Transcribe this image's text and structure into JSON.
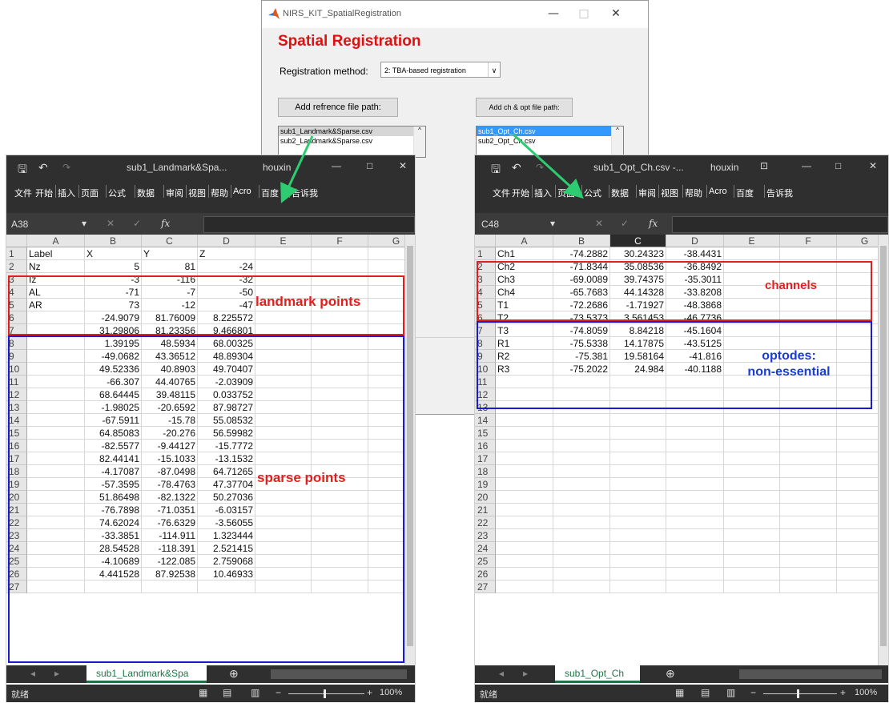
{
  "colors": {
    "accent_red": "#e02020",
    "accent_blue": "#1a3cd6",
    "excel_green": "#217346",
    "dark_ui": "#2f2f2f",
    "highlight": "#3399ff"
  },
  "matlab": {
    "window_title": "NIRS_KIT_SpatialRegistration",
    "heading": "Spatial Registration",
    "method_label": "Registration method:",
    "method_value": "2: TBA-based registration",
    "btn_ref": "Add refrence file path:",
    "btn_ch": "Add ch & opt file path:",
    "ref_files": [
      "sub1_Landmark&Sparse.csv",
      "sub2_Landmark&Sparse.csv"
    ],
    "ch_files": [
      "sub1_Opt_Ch.csv",
      "sub2_Opt_Ch.csv"
    ]
  },
  "excel_common": {
    "ribbon_tabs": [
      "文件",
      "开始",
      "插入",
      "页面",
      "公式",
      "数据",
      "审阅",
      "视图",
      "帮助",
      "Acro",
      "百度",
      "告诉我"
    ],
    "status": "就绪",
    "zoom": "100%",
    "fx": "fx"
  },
  "excel_left": {
    "title": "sub1_Landmark&Spa...",
    "user": "houxin",
    "name_box": "A38",
    "sheet_tab": "sub1_Landmark&Spa",
    "columns": [
      "A",
      "B",
      "C",
      "D",
      "E",
      "F",
      "G"
    ],
    "rows": [
      [
        "Label",
        "X",
        "Y",
        "Z"
      ],
      [
        "Nz",
        "5",
        "81",
        "-24"
      ],
      [
        "Iz",
        "-3",
        "-116",
        "-32"
      ],
      [
        "AL",
        "-71",
        "-7",
        "-50"
      ],
      [
        "AR",
        "73",
        "-12",
        "-47"
      ],
      [
        "",
        "-24.9079",
        "81.76009",
        "8.225572"
      ],
      [
        "",
        "31.29806",
        "81.23356",
        "9.466801"
      ],
      [
        "",
        "1.39195",
        "48.5934",
        "68.00325"
      ],
      [
        "",
        "-49.0682",
        "43.36512",
        "48.89304"
      ],
      [
        "",
        "49.52336",
        "40.8903",
        "49.70407"
      ],
      [
        "",
        "-66.307",
        "44.40765",
        "-2.03909"
      ],
      [
        "",
        "68.64445",
        "39.48115",
        "0.033752"
      ],
      [
        "",
        "-1.98025",
        "-20.6592",
        "87.98727"
      ],
      [
        "",
        "-67.5911",
        "-15.78",
        "55.08532"
      ],
      [
        "",
        "64.85083",
        "-20.276",
        "56.59982"
      ],
      [
        "",
        "-82.5577",
        "-9.44127",
        "-15.7772"
      ],
      [
        "",
        "82.44141",
        "-15.1033",
        "-13.1532"
      ],
      [
        "",
        "-4.17087",
        "-87.0498",
        "64.71265"
      ],
      [
        "",
        "-57.3595",
        "-78.4763",
        "47.37704"
      ],
      [
        "",
        "51.86498",
        "-82.1322",
        "50.27036"
      ],
      [
        "",
        "-76.7898",
        "-71.0351",
        "-6.03157"
      ],
      [
        "",
        "74.62024",
        "-76.6329",
        "-3.56055"
      ],
      [
        "",
        "-33.3851",
        "-114.911",
        "1.323444"
      ],
      [
        "",
        "28.54528",
        "-118.391",
        "2.521415"
      ],
      [
        "",
        "-4.10689",
        "-122.085",
        "2.759068"
      ],
      [
        "",
        "4.441528",
        "87.92538",
        "10.46933"
      ],
      [
        "",
        "",
        "",
        ""
      ]
    ],
    "anno_landmark": "landmark points",
    "anno_sparse": "sparse points"
  },
  "excel_right": {
    "title": "sub1_Opt_Ch.csv -...",
    "user": "houxin",
    "name_box": "C48",
    "sheet_tab": "sub1_Opt_Ch",
    "columns": [
      "A",
      "B",
      "C",
      "D",
      "E",
      "F",
      "G"
    ],
    "rows": [
      [
        "Ch1",
        "-74.2882",
        "30.24323",
        "-38.4431"
      ],
      [
        "Ch2",
        "-71.8344",
        "35.08536",
        "-36.8492"
      ],
      [
        "Ch3",
        "-69.0089",
        "39.74375",
        "-35.3011"
      ],
      [
        "Ch4",
        "-65.7683",
        "44.14328",
        "-33.8208"
      ],
      [
        "T1",
        "-72.2686",
        "-1.71927",
        "-48.3868"
      ],
      [
        "T2",
        "-73.5373",
        "3.561453",
        "-46.7736"
      ],
      [
        "T3",
        "-74.8059",
        "8.84218",
        "-45.1604"
      ],
      [
        "R1",
        "-75.5338",
        "14.17875",
        "-43.5125"
      ],
      [
        "R2",
        "-75.381",
        "19.58164",
        "-41.816"
      ],
      [
        "R3",
        "-75.2022",
        "24.984",
        "-40.1188"
      ],
      [
        "",
        "",
        "",
        ""
      ],
      [
        "",
        "",
        "",
        ""
      ],
      [
        "",
        "",
        "",
        ""
      ],
      [
        "",
        "",
        "",
        ""
      ],
      [
        "",
        "",
        "",
        ""
      ],
      [
        "",
        "",
        "",
        ""
      ],
      [
        "",
        "",
        "",
        ""
      ],
      [
        "",
        "",
        "",
        ""
      ],
      [
        "",
        "",
        "",
        ""
      ],
      [
        "",
        "",
        "",
        ""
      ],
      [
        "",
        "",
        "",
        ""
      ],
      [
        "",
        "",
        "",
        ""
      ],
      [
        "",
        "",
        "",
        ""
      ],
      [
        "",
        "",
        "",
        ""
      ],
      [
        "",
        "",
        "",
        ""
      ],
      [
        "",
        "",
        "",
        ""
      ],
      [
        "",
        "",
        "",
        ""
      ]
    ],
    "anno_channels": "channels",
    "anno_optodes": "optodes:",
    "anno_nonessential": "non-essential"
  }
}
